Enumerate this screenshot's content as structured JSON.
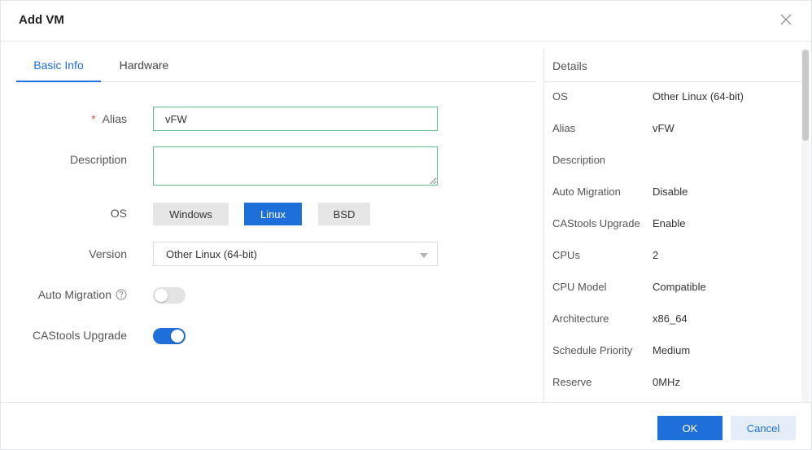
{
  "dialog": {
    "title": "Add VM"
  },
  "tabs": [
    {
      "label": "Basic Info",
      "active": true
    },
    {
      "label": "Hardware",
      "active": false
    }
  ],
  "form": {
    "alias": {
      "label": "Alias",
      "required_mark": "*",
      "value": "vFW"
    },
    "description": {
      "label": "Description",
      "value": ""
    },
    "os": {
      "label": "OS",
      "options": [
        "Windows",
        "Linux",
        "BSD"
      ],
      "selected": "Linux"
    },
    "version": {
      "label": "Version",
      "value": "Other Linux (64-bit)"
    },
    "auto_migration": {
      "label": "Auto Migration",
      "enabled": false
    },
    "castools_upgrade": {
      "label": "CAStools Upgrade",
      "enabled": true
    }
  },
  "details": {
    "title": "Details",
    "rows": [
      {
        "key": "OS",
        "value": "Other Linux (64-bit)"
      },
      {
        "key": "Alias",
        "value": "vFW"
      },
      {
        "key": "Description",
        "value": ""
      },
      {
        "key": "Auto Migration",
        "value": "Disable"
      },
      {
        "key": "CAStools Upgrade",
        "value": "Enable"
      },
      {
        "key": "CPUs",
        "value": "2"
      },
      {
        "key": "CPU Model",
        "value": "Compatible"
      },
      {
        "key": "Architecture",
        "value": "x86_64"
      },
      {
        "key": "Schedule Priority",
        "value": "Medium"
      },
      {
        "key": "Reserve",
        "value": "0MHz"
      }
    ]
  },
  "footer": {
    "ok_label": "OK",
    "cancel_label": "Cancel"
  },
  "colors": {
    "primary": "#1e6fd9",
    "input_border_valid": "#5fb88a",
    "required": "#e34a4a"
  },
  "icons": {
    "close": "close-icon",
    "help": "question-circle-icon",
    "dropdown": "chevron-down-icon"
  }
}
